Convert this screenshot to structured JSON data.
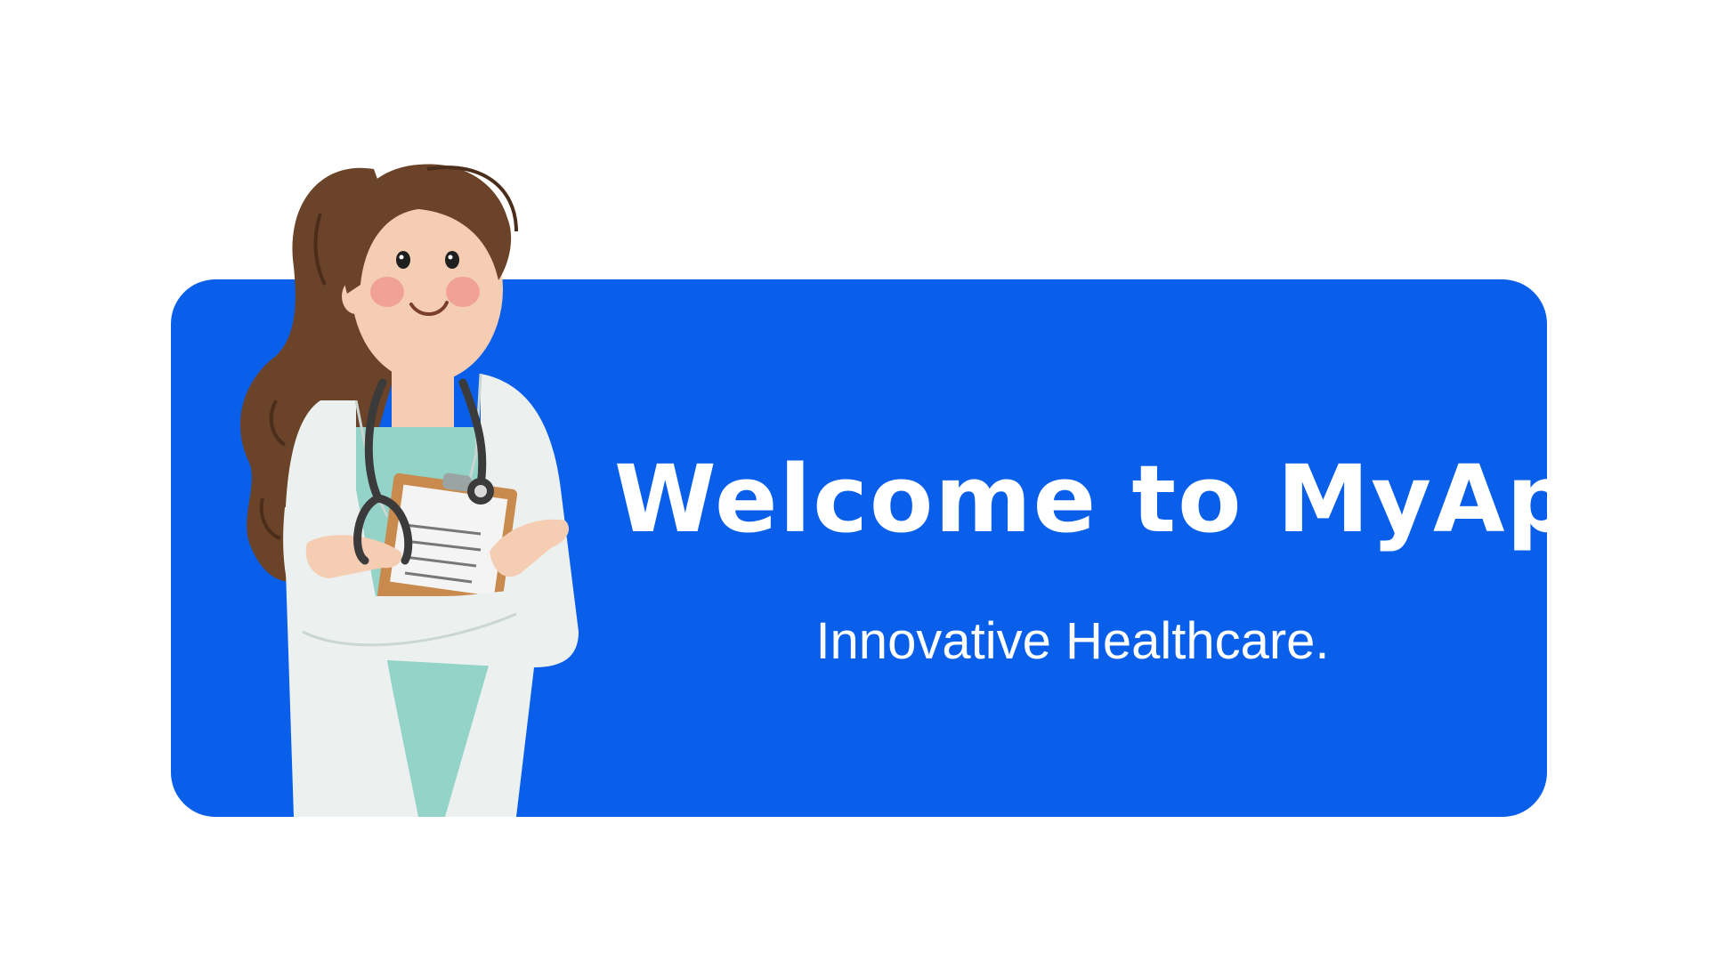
{
  "banner": {
    "title": "Welcome to MyApp!",
    "subtitle": "Innovative Healthcare."
  },
  "illustration": {
    "subject": "doctor-illustration",
    "items": [
      "stethoscope-icon",
      "clipboard-icon"
    ]
  },
  "colors": {
    "background": "#ffffff",
    "banner": "#0a5fea",
    "text": "#ffffff",
    "hair": "#6a4328",
    "coat": "#ecf1f0",
    "scrubs": "#94d3c8",
    "skin": "#f4cdb2",
    "clipboard": "#c98a4e"
  }
}
